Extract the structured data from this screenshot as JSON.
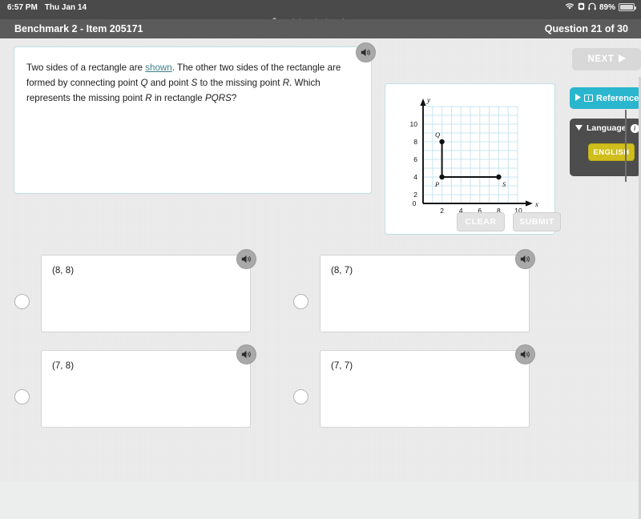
{
  "status_bar": {
    "time": "6:57 PM",
    "date": "Thu Jan 14",
    "battery_percent": "89%",
    "icons": [
      "wifi-icon",
      "alarm-icon",
      "headphones-icon",
      "battery-icon"
    ]
  },
  "browser": {
    "url": "math.imaginelearning.com",
    "lock_icon": "lock-icon"
  },
  "app_header": {
    "title": "Benchmark 2 - Item 205171",
    "question_counter": "Question 21 of 30"
  },
  "question": {
    "part1": "Two sides of a rectangle are ",
    "link": "shown",
    "part2": ". The other two sides of the rectangle are formed by connecting point ",
    "q_label": "Q",
    "part3": " and point ",
    "s_label": "S",
    "part4": " to the missing point ",
    "r_label": "R",
    "part5": ". Which represents the missing point ",
    "r_label2": "R",
    "part6": " in rectangle ",
    "pqrs_label": "PQRS",
    "part7": "?",
    "speaker_icon": "speaker-icon"
  },
  "chart_data": {
    "type": "scatter",
    "title": "",
    "xlabel": "x",
    "ylabel": "y",
    "xlim": [
      0,
      11
    ],
    "ylim": [
      0,
      11
    ],
    "xticks": [
      0,
      2,
      4,
      6,
      8,
      10
    ],
    "yticks": [
      0,
      2,
      4,
      6,
      8,
      10
    ],
    "grid": true,
    "grid_color": "#c9e4f0",
    "origin_label": "0",
    "points": [
      {
        "label": "P",
        "x": 2,
        "y": 3,
        "label_pos": "below-left"
      },
      {
        "label": "Q",
        "x": 2,
        "y": 7,
        "label_pos": "above-left"
      },
      {
        "label": "S",
        "x": 8,
        "y": 3,
        "label_pos": "below-right"
      }
    ],
    "segments": [
      {
        "from": "P",
        "to": "Q"
      },
      {
        "from": "P",
        "to": "S"
      }
    ]
  },
  "actions": {
    "clear_label": "CLEAR",
    "submit_label": "SUBMIT"
  },
  "rail": {
    "next_label": "NEXT",
    "next_icon": "play-triangle-icon",
    "reference_label": "Reference",
    "reference_arrow_icon": "play-triangle-icon",
    "reference_book_icon": "book-icon",
    "reference_color": "#29b6ce",
    "language_label": "Language",
    "language_caret_icon": "caret-down-icon",
    "language_info_icon": "info-icon",
    "english_label": "ENGLISH",
    "english_color": "#cfbe1b"
  },
  "answers": [
    {
      "id": "a",
      "text": "(8, 8)",
      "selected": false,
      "speaker_icon": "speaker-icon"
    },
    {
      "id": "b",
      "text": "(8, 7)",
      "selected": false,
      "speaker_icon": "speaker-icon"
    },
    {
      "id": "c",
      "text": "(7, 8)",
      "selected": false,
      "speaker_icon": "speaker-icon"
    },
    {
      "id": "d",
      "text": "(7, 7)",
      "selected": false,
      "speaker_icon": "speaker-icon"
    }
  ]
}
